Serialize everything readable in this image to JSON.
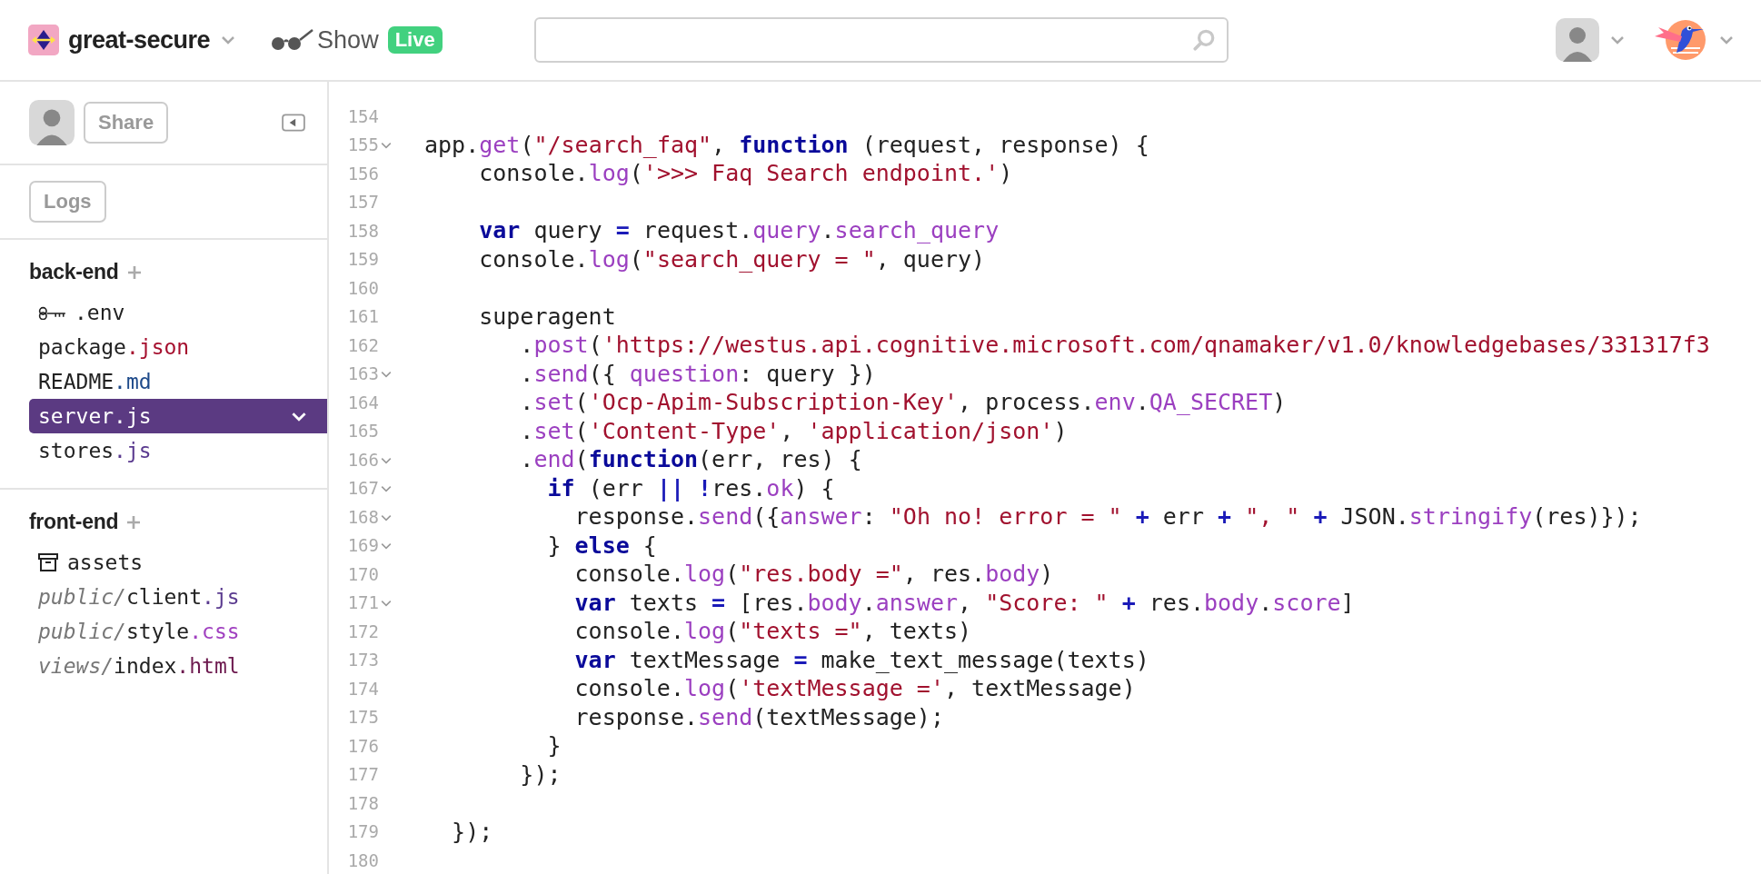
{
  "header": {
    "project": "great-secure",
    "show_label": "Show",
    "live_badge": "Live"
  },
  "sidebar": {
    "share_button": "Share",
    "logs_button": "Logs",
    "sections": [
      {
        "title": "back-end",
        "files": [
          {
            "kind": "env",
            "name": ".env",
            "selected": false
          },
          {
            "kind": "file",
            "name": "package",
            "ext": ".json",
            "color": "#a50e2d",
            "selected": false
          },
          {
            "kind": "file",
            "name": "README",
            "ext": ".md",
            "color": "#1e4a8a",
            "selected": false
          },
          {
            "kind": "file",
            "name": "server",
            "ext": ".js",
            "color": "#ffffff",
            "selected": true
          },
          {
            "kind": "file",
            "name": "stores",
            "ext": ".js",
            "color": "#5a3a8f",
            "selected": false
          }
        ]
      },
      {
        "title": "front-end",
        "files": [
          {
            "kind": "assets",
            "name": "assets",
            "selected": false
          },
          {
            "kind": "file",
            "dir": "public/",
            "name": "client",
            "ext": ".js",
            "color": "#5a3a8f",
            "selected": false
          },
          {
            "kind": "file",
            "dir": "public/",
            "name": "style",
            "ext": ".css",
            "color": "#a040c0",
            "selected": false
          },
          {
            "kind": "file",
            "dir": "views/",
            "name": "index",
            "ext": ".html",
            "color": "#6d1a4f",
            "selected": false
          }
        ]
      }
    ]
  },
  "editor": {
    "lines": [
      {
        "number": "154",
        "foldable": false
      },
      {
        "number": "155",
        "foldable": true,
        "tokens": [
          {
            "kind": "plain",
            "text": "app."
          },
          {
            "kind": "prop",
            "text": "get"
          },
          {
            "kind": "plain",
            "text": "("
          },
          {
            "kind": "str",
            "text": "\"/search_faq\""
          },
          {
            "kind": "plain",
            "text": ", "
          },
          {
            "kind": "kw",
            "text": "function"
          },
          {
            "kind": "plain",
            "text": " (request, response) {"
          }
        ]
      },
      {
        "number": "156",
        "foldable": false,
        "tokens": [
          {
            "kind": "plain",
            "text": "    console."
          },
          {
            "kind": "prop",
            "text": "log"
          },
          {
            "kind": "plain",
            "text": "("
          },
          {
            "kind": "str",
            "text": "'>>> Faq Search endpoint.'"
          },
          {
            "kind": "plain",
            "text": ")"
          }
        ]
      },
      {
        "number": "157",
        "foldable": false
      },
      {
        "number": "158",
        "foldable": false,
        "tokens": [
          {
            "kind": "kw",
            "text": "    var"
          },
          {
            "kind": "plain",
            "text": " query "
          },
          {
            "kind": "op",
            "text": "="
          },
          {
            "kind": "plain",
            "text": " request."
          },
          {
            "kind": "prop",
            "text": "query"
          },
          {
            "kind": "plain",
            "text": "."
          },
          {
            "kind": "prop",
            "text": "search_query"
          }
        ]
      },
      {
        "number": "159",
        "foldable": false,
        "tokens": [
          {
            "kind": "plain",
            "text": "    console."
          },
          {
            "kind": "prop",
            "text": "log"
          },
          {
            "kind": "plain",
            "text": "("
          },
          {
            "kind": "str",
            "text": "\"search_query = \""
          },
          {
            "kind": "plain",
            "text": ", query)"
          }
        ]
      },
      {
        "number": "160",
        "foldable": false
      },
      {
        "number": "161",
        "foldable": false,
        "tokens": [
          {
            "kind": "plain",
            "text": "    superagent"
          }
        ]
      },
      {
        "number": "162",
        "foldable": false,
        "tokens": [
          {
            "kind": "plain",
            "text": "       ."
          },
          {
            "kind": "prop",
            "text": "post"
          },
          {
            "kind": "plain",
            "text": "("
          },
          {
            "kind": "str",
            "text": "'https://westus.api.cognitive.microsoft.com/qnamaker/v1.0/knowledgebases/331317f3"
          }
        ]
      },
      {
        "number": "163",
        "foldable": true,
        "tokens": [
          {
            "kind": "plain",
            "text": "       ."
          },
          {
            "kind": "prop",
            "text": "send"
          },
          {
            "kind": "plain",
            "text": "({ "
          },
          {
            "kind": "prop",
            "text": "question"
          },
          {
            "kind": "plain",
            "text": ": query })"
          }
        ]
      },
      {
        "number": "164",
        "foldable": false,
        "tokens": [
          {
            "kind": "plain",
            "text": "       ."
          },
          {
            "kind": "prop",
            "text": "set"
          },
          {
            "kind": "plain",
            "text": "("
          },
          {
            "kind": "str",
            "text": "'Ocp-Apim-Subscription-Key'"
          },
          {
            "kind": "plain",
            "text": ", process."
          },
          {
            "kind": "prop",
            "text": "env"
          },
          {
            "kind": "plain",
            "text": "."
          },
          {
            "kind": "prop",
            "text": "QA_SECRET"
          },
          {
            "kind": "plain",
            "text": ")"
          }
        ]
      },
      {
        "number": "165",
        "foldable": false,
        "tokens": [
          {
            "kind": "plain",
            "text": "       ."
          },
          {
            "kind": "prop",
            "text": "set"
          },
          {
            "kind": "plain",
            "text": "("
          },
          {
            "kind": "str",
            "text": "'Content-Type'"
          },
          {
            "kind": "plain",
            "text": ", "
          },
          {
            "kind": "str",
            "text": "'application/json'"
          },
          {
            "kind": "plain",
            "text": ")"
          }
        ]
      },
      {
        "number": "166",
        "foldable": true,
        "tokens": [
          {
            "kind": "plain",
            "text": "       ."
          },
          {
            "kind": "prop",
            "text": "end"
          },
          {
            "kind": "plain",
            "text": "("
          },
          {
            "kind": "kw",
            "text": "function"
          },
          {
            "kind": "plain",
            "text": "(err, res) {"
          }
        ]
      },
      {
        "number": "167",
        "foldable": true,
        "tokens": [
          {
            "kind": "kw",
            "text": "         if"
          },
          {
            "kind": "plain",
            "text": " (err "
          },
          {
            "kind": "op",
            "text": "||"
          },
          {
            "kind": "op",
            "text": " !"
          },
          {
            "kind": "plain",
            "text": "res."
          },
          {
            "kind": "prop",
            "text": "ok"
          },
          {
            "kind": "plain",
            "text": ") {"
          }
        ]
      },
      {
        "number": "168",
        "foldable": true,
        "tokens": [
          {
            "kind": "plain",
            "text": "           response."
          },
          {
            "kind": "prop",
            "text": "send"
          },
          {
            "kind": "plain",
            "text": "({"
          },
          {
            "kind": "prop",
            "text": "answer"
          },
          {
            "kind": "plain",
            "text": ": "
          },
          {
            "kind": "str",
            "text": "\"Oh no! error = \""
          },
          {
            "kind": "op",
            "text": " +"
          },
          {
            "kind": "plain",
            "text": " err "
          },
          {
            "kind": "op",
            "text": "+"
          },
          {
            "kind": "str",
            "text": " \", \""
          },
          {
            "kind": "op",
            "text": " +"
          },
          {
            "kind": "plain",
            "text": " JSON."
          },
          {
            "kind": "prop",
            "text": "stringify"
          },
          {
            "kind": "plain",
            "text": "(res)});"
          }
        ]
      },
      {
        "number": "169",
        "foldable": true,
        "tokens": [
          {
            "kind": "plain",
            "text": "         } "
          },
          {
            "kind": "kw",
            "text": "else"
          },
          {
            "kind": "plain",
            "text": " {"
          }
        ]
      },
      {
        "number": "170",
        "foldable": false,
        "tokens": [
          {
            "kind": "plain",
            "text": "           console."
          },
          {
            "kind": "prop",
            "text": "log"
          },
          {
            "kind": "plain",
            "text": "("
          },
          {
            "kind": "str",
            "text": "\"res.body =\""
          },
          {
            "kind": "plain",
            "text": ", res."
          },
          {
            "kind": "prop",
            "text": "body"
          },
          {
            "kind": "plain",
            "text": ")"
          }
        ]
      },
      {
        "number": "171",
        "foldable": true,
        "tokens": [
          {
            "kind": "kw",
            "text": "           var"
          },
          {
            "kind": "plain",
            "text": " texts "
          },
          {
            "kind": "op",
            "text": "="
          },
          {
            "kind": "plain",
            "text": " [res."
          },
          {
            "kind": "prop",
            "text": "body"
          },
          {
            "kind": "plain",
            "text": "."
          },
          {
            "kind": "prop",
            "text": "answer"
          },
          {
            "kind": "plain",
            "text": ", "
          },
          {
            "kind": "str",
            "text": "\"Score: \""
          },
          {
            "kind": "op",
            "text": " +"
          },
          {
            "kind": "plain",
            "text": " res."
          },
          {
            "kind": "prop",
            "text": "body"
          },
          {
            "kind": "plain",
            "text": "."
          },
          {
            "kind": "prop",
            "text": "score"
          },
          {
            "kind": "plain",
            "text": "]"
          }
        ]
      },
      {
        "number": "172",
        "foldable": false,
        "tokens": [
          {
            "kind": "plain",
            "text": "           console."
          },
          {
            "kind": "prop",
            "text": "log"
          },
          {
            "kind": "plain",
            "text": "("
          },
          {
            "kind": "str",
            "text": "\"texts =\""
          },
          {
            "kind": "plain",
            "text": ", texts)"
          }
        ]
      },
      {
        "number": "173",
        "foldable": false,
        "tokens": [
          {
            "kind": "kw",
            "text": "           var"
          },
          {
            "kind": "plain",
            "text": " textMessage "
          },
          {
            "kind": "op",
            "text": "="
          },
          {
            "kind": "plain",
            "text": " make_text_message(texts)"
          }
        ]
      },
      {
        "number": "174",
        "foldable": false,
        "tokens": [
          {
            "kind": "plain",
            "text": "           console."
          },
          {
            "kind": "prop",
            "text": "log"
          },
          {
            "kind": "plain",
            "text": "("
          },
          {
            "kind": "str",
            "text": "'textMessage ='"
          },
          {
            "kind": "plain",
            "text": ", textMessage)"
          }
        ]
      },
      {
        "number": "175",
        "foldable": false,
        "tokens": [
          {
            "kind": "plain",
            "text": "           response."
          },
          {
            "kind": "prop",
            "text": "send"
          },
          {
            "kind": "plain",
            "text": "(textMessage);"
          }
        ]
      },
      {
        "number": "176",
        "foldable": false,
        "tokens": [
          {
            "kind": "plain",
            "text": "         }"
          }
        ]
      },
      {
        "number": "177",
        "foldable": false,
        "tokens": [
          {
            "kind": "plain",
            "text": "       });"
          }
        ]
      },
      {
        "number": "178",
        "foldable": false
      },
      {
        "number": "179",
        "foldable": false,
        "tokens": [
          {
            "kind": "plain",
            "text": "  });"
          }
        ]
      },
      {
        "number": "180",
        "foldable": false
      }
    ]
  }
}
